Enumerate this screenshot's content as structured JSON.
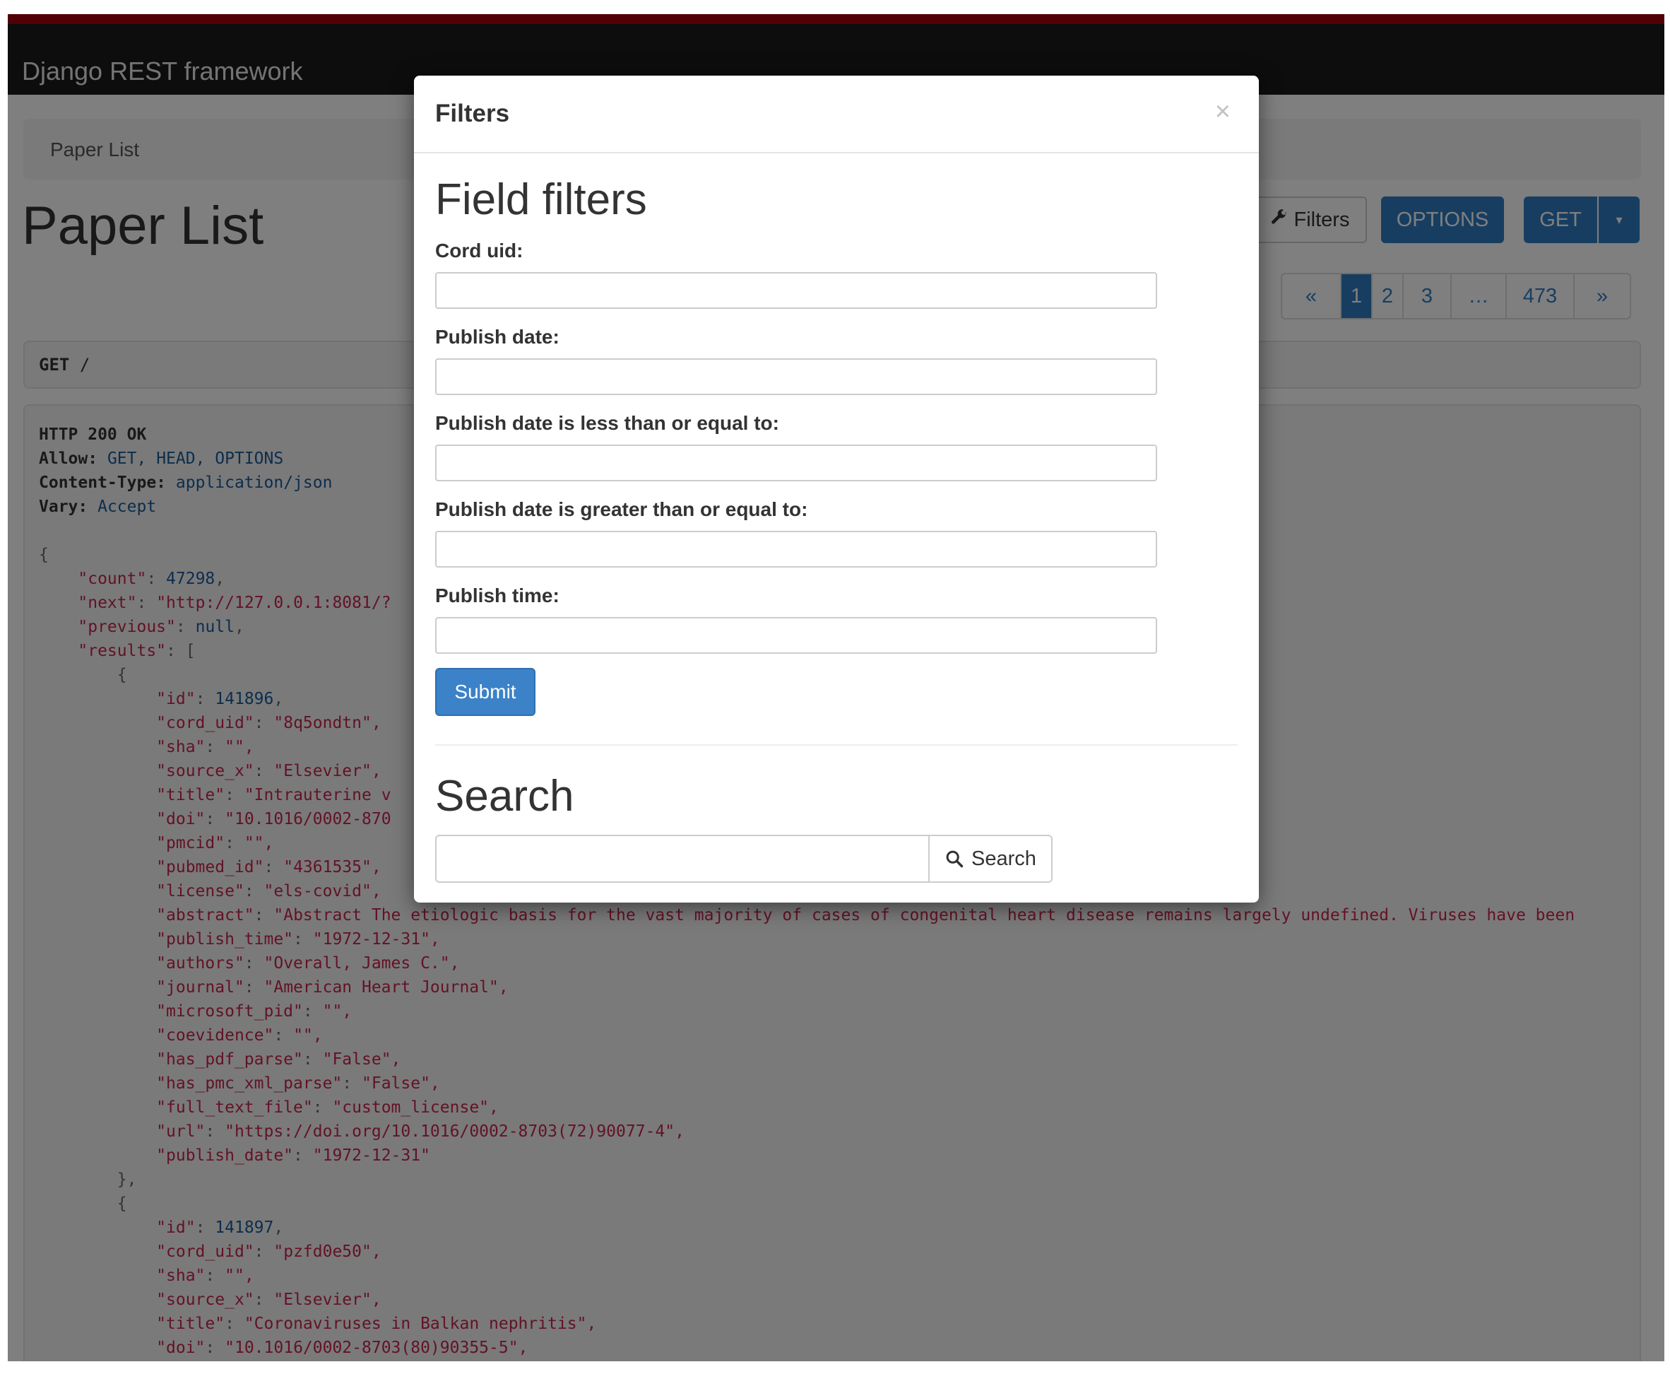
{
  "navbar": {
    "brand": "Django REST framework"
  },
  "breadcrumb": {
    "item": "Paper List"
  },
  "page": {
    "title": "Paper List"
  },
  "toolbar": {
    "filters_label": "Filters",
    "options_label": "OPTIONS",
    "get_label": "GET",
    "caret": "▾",
    "filters_icon": "wrench-icon"
  },
  "pagination": {
    "prev": "«",
    "pages": [
      "1",
      "2",
      "3",
      "…",
      "473"
    ],
    "next": "»",
    "active": "1"
  },
  "request": {
    "method": "GET",
    "path": "/"
  },
  "response": {
    "status": "HTTP 200 OK",
    "headers": [
      {
        "name": "Allow",
        "value": "GET, HEAD, OPTIONS"
      },
      {
        "name": "Content-Type",
        "value": "application/json"
      },
      {
        "name": "Vary",
        "value": "Accept"
      }
    ],
    "count": "47298",
    "next": "\"http://127.0.0.1:8081/?",
    "previous": "null",
    "results": [
      {
        "id": "141896",
        "cord_uid": "\"8q5ondtn\",",
        "sha": "\"\",",
        "source_x": "\"Elsevier\",",
        "title": "\"Intrauterine v",
        "doi": "\"10.1016/0002-870",
        "pmcid": "\"\",",
        "pubmed_id": "\"4361535\",",
        "license": "\"els-covid\",",
        "abstract": "\"Abstract The etiologic basis for the vast majority of cases of congenital heart disease remains largely undefined. Viruses have been",
        "publish_time": "\"1972-12-31\",",
        "authors": "\"Overall, James C.\",",
        "journal": "\"American Heart Journal\",",
        "microsoft_pid": "\"\",",
        "coevidence": "\"\",",
        "has_pdf_parse": "\"False\",",
        "has_pmc_xml_parse": "\"False\",",
        "full_text_file": "\"custom_license\",",
        "url": "\"https://doi.org/10.1016/0002-8703(72)90077-4\",",
        "publish_date": "\"1972-12-31\""
      },
      {
        "id": "141897",
        "cord_uid": "\"pzfd0e50\",",
        "sha": "\"\",",
        "source_x": "\"Elsevier\",",
        "title": "\"Coronaviruses in Balkan nephritis\",",
        "doi": "\"10.1016/0002-8703(80)90355-5\","
      }
    ]
  },
  "modal": {
    "title": "Filters",
    "close": "×",
    "field_filters_heading": "Field filters",
    "fields": [
      {
        "label": "Cord uid:",
        "value": ""
      },
      {
        "label": "Publish date:",
        "value": ""
      },
      {
        "label": "Publish date is less than or equal to:",
        "value": ""
      },
      {
        "label": "Publish date is greater than or equal to:",
        "value": ""
      },
      {
        "label": "Publish time:",
        "value": ""
      }
    ],
    "submit_label": "Submit",
    "search_heading": "Search",
    "search_value": "",
    "search_button_label": "Search",
    "search_icon": "search-icon"
  },
  "colors": {
    "navbar_bg": "#1b1b1b",
    "navbar_accent": "#a3000b",
    "primary": "#2f7cc3",
    "json_key": "#c7254e",
    "json_number": "#1a5a9a"
  }
}
